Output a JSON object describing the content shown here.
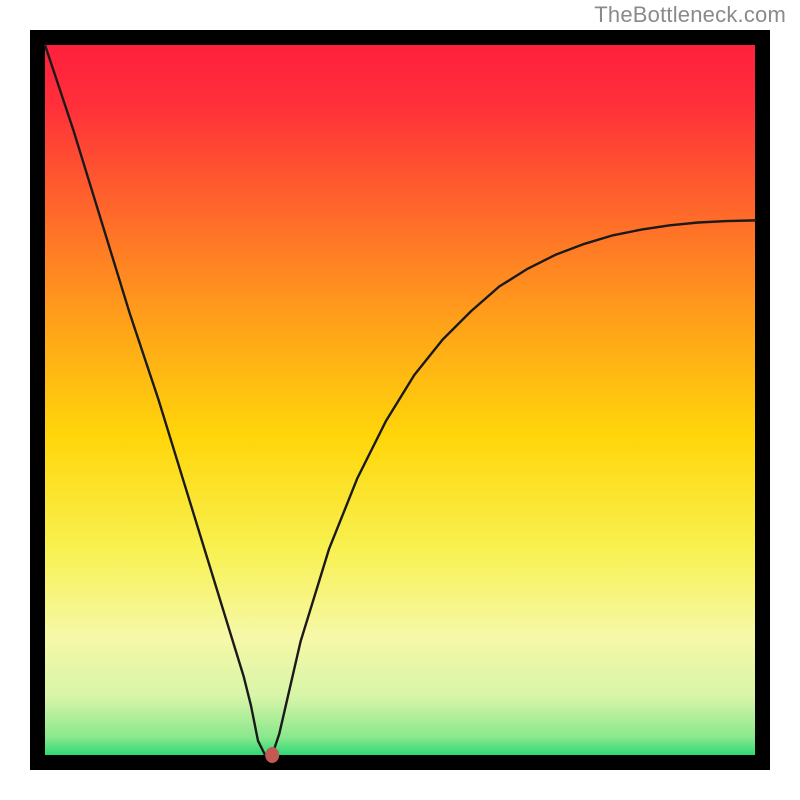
{
  "watermark": "TheBottleneck.com",
  "chart_data": {
    "type": "line",
    "title": "",
    "xlabel": "",
    "ylabel": "",
    "xlim": [
      0,
      100
    ],
    "ylim": [
      0,
      100
    ],
    "optimum_x": 31,
    "series": [
      {
        "name": "bottleneck-curve",
        "x": [
          0,
          4,
          8,
          12,
          16,
          20,
          24,
          28,
          29,
          30,
          31,
          32,
          33,
          36,
          40,
          44,
          48,
          52,
          56,
          60,
          64,
          68,
          72,
          76,
          80,
          84,
          88,
          92,
          96,
          100
        ],
        "values": [
          100,
          88,
          75,
          62,
          50,
          37,
          24,
          11,
          7,
          2,
          0,
          0,
          3,
          16,
          29,
          39,
          47,
          53.5,
          58.5,
          62.5,
          66,
          68.5,
          70.5,
          72,
          73.2,
          74,
          74.6,
          75,
          75.2,
          75.3
        ]
      }
    ],
    "marker": {
      "x": 32,
      "y": 0,
      "color": "#c25a54"
    },
    "background_gradient": {
      "stops": [
        {
          "offset": 0.0,
          "color": "#ff1c3d"
        },
        {
          "offset": 0.1,
          "color": "#ff2f3a"
        },
        {
          "offset": 0.25,
          "color": "#ff6a2a"
        },
        {
          "offset": 0.4,
          "color": "#ffa319"
        },
        {
          "offset": 0.55,
          "color": "#ffd60a"
        },
        {
          "offset": 0.7,
          "color": "#f8f150"
        },
        {
          "offset": 0.82,
          "color": "#f6f8a8"
        },
        {
          "offset": 0.9,
          "color": "#d8f5a8"
        },
        {
          "offset": 0.955,
          "color": "#8be88d"
        },
        {
          "offset": 0.98,
          "color": "#2fd877"
        },
        {
          "offset": 1.0,
          "color": "#14c96a"
        }
      ]
    },
    "frame_color": "#000000",
    "curve_color": "#1a1a1a",
    "curve_width": 2.4
  }
}
